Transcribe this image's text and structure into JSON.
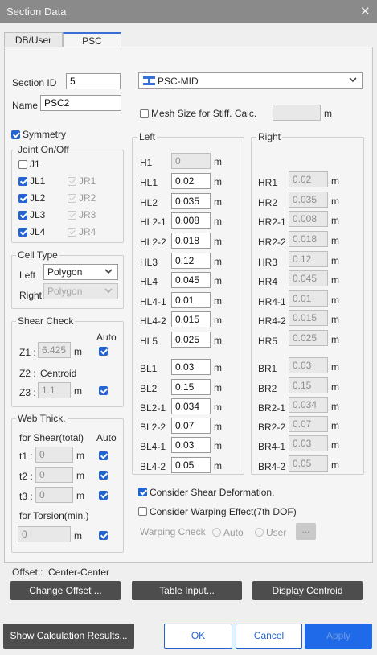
{
  "window": {
    "title": "Section Data"
  },
  "tabs": [
    "DB/User",
    "PSC"
  ],
  "section_id": {
    "label": "Section ID",
    "value": "5"
  },
  "name": {
    "label": "Name",
    "value": "PSC2"
  },
  "section_type": {
    "value": "PSC-MID"
  },
  "mesh": {
    "label": "Mesh Size for Stiff. Calc.",
    "value": "",
    "unit": "m"
  },
  "symmetry": {
    "label": "Symmetry"
  },
  "joint": {
    "title": "Joint On/Off",
    "j1": "J1",
    "left": [
      "JL1",
      "JL2",
      "JL3",
      "JL4"
    ],
    "right": [
      "JR1",
      "JR2",
      "JR3",
      "JR4"
    ]
  },
  "cell_type": {
    "title": "Cell Type",
    "left_label": "Left",
    "left_value": "Polygon",
    "right_label": "Right",
    "right_value": "Polygon"
  },
  "shear_check": {
    "title": "Shear Check",
    "auto_label": "Auto",
    "z1_label": "Z1 :",
    "z1_value": "6.425",
    "z2_label": "Z2 :",
    "z2_value": "Centroid",
    "z3_label": "Z3 :",
    "z3_value": "1.1",
    "unit": "m"
  },
  "web_thick": {
    "title": "Web Thick.",
    "shear_label": "for Shear(total)",
    "auto_label": "Auto",
    "t1_label": "t1 :",
    "t2_label": "t2 :",
    "t3_label": "t3 :",
    "t1_value": "0",
    "t2_value": "0",
    "t3_value": "0",
    "torsion_label": "for Torsion(min.)",
    "torsion_value": "0",
    "unit": "m"
  },
  "left_dims": {
    "title": "Left",
    "unit": "m",
    "rows": [
      {
        "label": "H1",
        "value": "0"
      },
      {
        "label": "HL1",
        "value": "0.02"
      },
      {
        "label": "HL2",
        "value": "0.035"
      },
      {
        "label": "HL2-1",
        "value": "0.008"
      },
      {
        "label": "HL2-2",
        "value": "0.018"
      },
      {
        "label": "HL3",
        "value": "0.12"
      },
      {
        "label": "HL4",
        "value": "0.045"
      },
      {
        "label": "HL4-1",
        "value": "0.01"
      },
      {
        "label": "HL4-2",
        "value": "0.015"
      },
      {
        "label": "HL5",
        "value": "0.025"
      },
      {
        "label": "BL1",
        "value": "0.03"
      },
      {
        "label": "BL2",
        "value": "0.15"
      },
      {
        "label": "BL2-1",
        "value": "0.034"
      },
      {
        "label": "BL2-2",
        "value": "0.07"
      },
      {
        "label": "BL4-1",
        "value": "0.03"
      },
      {
        "label": "BL4-2",
        "value": "0.05"
      }
    ]
  },
  "right_dims": {
    "title": "Right",
    "unit": "m",
    "rows": [
      {
        "label": "HR1",
        "value": "0.02"
      },
      {
        "label": "HR2",
        "value": "0.035"
      },
      {
        "label": "HR2-1",
        "value": "0.008"
      },
      {
        "label": "HR2-2",
        "value": "0.018"
      },
      {
        "label": "HR3",
        "value": "0.12"
      },
      {
        "label": "HR4",
        "value": "0.045"
      },
      {
        "label": "HR4-1",
        "value": "0.01"
      },
      {
        "label": "HR4-2",
        "value": "0.015"
      },
      {
        "label": "HR5",
        "value": "0.025"
      },
      {
        "label": "BR1",
        "value": "0.03"
      },
      {
        "label": "BR2",
        "value": "0.15"
      },
      {
        "label": "BR2-1",
        "value": "0.034"
      },
      {
        "label": "BR2-2",
        "value": "0.07"
      },
      {
        "label": "BR4-1",
        "value": "0.03"
      },
      {
        "label": "BR4-2",
        "value": "0.05"
      }
    ]
  },
  "options": {
    "shear_def": "Consider Shear Deformation.",
    "warping": "Consider Warping Effect(7th DOF)",
    "warping_check": "Warping Check",
    "auto": "Auto",
    "user": "User",
    "ellipsis": "..."
  },
  "offset": {
    "label": "Offset :",
    "value": "Center-Center"
  },
  "buttons": {
    "change_offset": "Change Offset ...",
    "table_input": "Table Input...",
    "display_centroid": "Display Centroid",
    "show_calc": "Show Calculation Results...",
    "ok": "OK",
    "cancel": "Cancel",
    "apply": "Apply"
  },
  "colors": {
    "accent": "#2364d2",
    "titlebar": "#8a8a8a",
    "dark_button": "#4d4d4d"
  }
}
